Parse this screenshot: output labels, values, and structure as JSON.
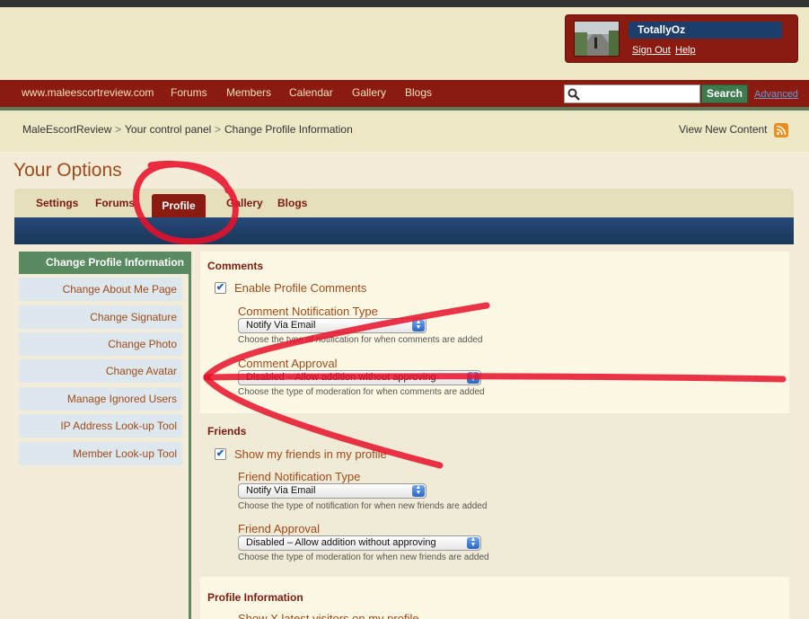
{
  "user": {
    "name": "TotallyOz",
    "sign_out": "Sign Out",
    "help": "Help"
  },
  "nav": {
    "items": [
      "www.maleescortreview.com",
      "Forums",
      "Members",
      "Calendar",
      "Gallery",
      "Blogs"
    ],
    "search_button": "Search",
    "search_value": "",
    "advanced": "Advanced"
  },
  "breadcrumb": {
    "items": [
      "MaleEscortReview",
      "Your control panel",
      "Change Profile Information"
    ],
    "separator": ">",
    "view_new": "View New Content"
  },
  "page_title": "Your Options",
  "tabs": {
    "items": [
      "Settings",
      "Forums",
      "Profile",
      "Gallery",
      "Blogs"
    ],
    "active": "Profile"
  },
  "sidebar": {
    "heading": "Change Profile Information",
    "items": [
      "Change About Me Page",
      "Change Signature",
      "Change Photo",
      "Change Avatar",
      "Manage Ignored Users",
      "IP Address Look-up Tool",
      "Member Look-up Tool"
    ]
  },
  "comments": {
    "title": "Comments",
    "enable_label": "Enable Profile Comments",
    "enable_checked": true,
    "notification_label": "Comment Notification Type",
    "notification_value": "Notify Via Email",
    "notification_help": "Choose the type of notification for when comments are added",
    "approval_label": "Comment Approval",
    "approval_value": "Disabled – Allow addition without approving",
    "approval_help": "Choose the type of moderation for when comments are added"
  },
  "friends": {
    "title": "Friends",
    "show_label": "Show my friends in my profile",
    "show_checked": true,
    "notification_label": "Friend Notification Type",
    "notification_value": "Notify Via Email",
    "notification_help": "Choose the type of notification for when new friends are added",
    "approval_label": "Friend Approval",
    "approval_value": "Disabled – Allow addition without approving",
    "approval_help": "Choose the type of moderation for when new friends are added"
  },
  "profile_info": {
    "title": "Profile Information",
    "latest_visitors_label": "Show X latest visitors on my profile"
  },
  "colors": {
    "brand_red": "#8b1a10",
    "accent_green": "#5a8a60",
    "link_orange": "#a04a1a",
    "tab_blue": "#1d3d6a",
    "annotation": "#e8102a"
  },
  "icons": [
    "search-icon",
    "rss-icon",
    "dropdown-arrow-icon",
    "checkmark-icon"
  ]
}
